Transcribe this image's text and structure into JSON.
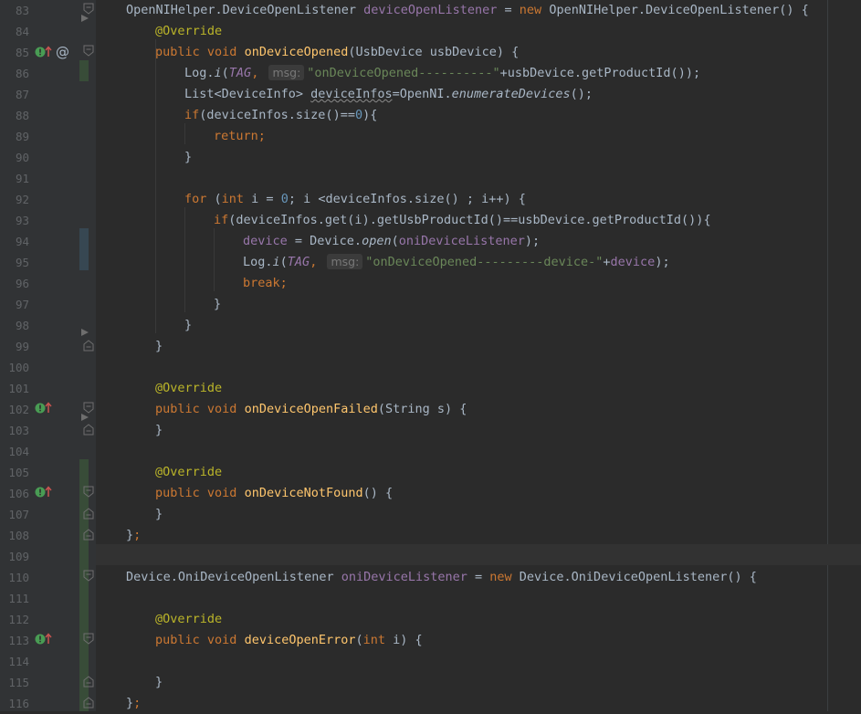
{
  "editor": {
    "colors": {
      "background": "#2b2b2b",
      "gutter": "#313335",
      "keyword": "#cc7832",
      "annotation": "#bbb529",
      "string": "#6a8759",
      "number": "#6897bb",
      "field": "#9876aa",
      "method_decl": "#ffc66d",
      "text": "#a9b7c6"
    },
    "line_numbers": [
      "83",
      "84",
      "85",
      "86",
      "87",
      "88",
      "89",
      "90",
      "91",
      "92",
      "93",
      "94",
      "95",
      "96",
      "97",
      "98",
      "99",
      "100",
      "101",
      "102",
      "103",
      "104",
      "105",
      "106",
      "107",
      "108",
      "109",
      "110",
      "111",
      "112",
      "113",
      "114",
      "115",
      "116"
    ],
    "tokens": {
      "l83_a": "OpenNIHelper.DeviceOpenListener ",
      "l83_b": "deviceOpenListener",
      "l83_c": " = ",
      "l83_d": "new",
      "l83_e": " OpenNIHelper.DeviceOpenListener() {",
      "override": "@Override",
      "public": "public",
      "void": "void",
      "l85_fn": "onDeviceOpened",
      "l85_rest": "(UsbDevice usbDevice) {",
      "log": "Log.",
      "i": "i",
      "tag": "TAG",
      "msg_hint": "msg:",
      "l86_str": "\"onDeviceOpened----------\"",
      "l86_rest": "+usbDevice.getProductId());",
      "l87_a": "List<DeviceInfo> ",
      "l87_b": "deviceInfos",
      "l87_c": "=OpenNI.",
      "l87_d": "enumerateDevices",
      "l87_e": "();",
      "if": "if",
      "l88_a": "(deviceInfos.size()==",
      "zero": "0",
      "l88_b": "){",
      "return": "return;",
      "close_brace": "}",
      "for": "for",
      "int": "int",
      "l92_a": " (",
      "l92_b": " i = ",
      "l92_c": "; i <deviceInfos.size() ; i++) {",
      "l93_a": "(deviceInfos.get(i).getUsbProductId()==usbDevice.getProductId()){",
      "device": "device",
      "l94_a": " = Device.",
      "open": "open",
      "l94_b": "(",
      "oni_listener": "oniDeviceListener",
      "l94_c": ");",
      "l95_str": "\"onDeviceOpened---------device-\"",
      "plus": "+",
      "l95_c": ");",
      "break": "break;",
      "l102_fn": "onDeviceOpenFailed",
      "l102_rest": "(String s) {",
      "l106_fn": "onDeviceNotFound",
      "l106_rest": "() {",
      "close_semi": "};",
      "l110_a": "Device.OniDeviceOpenListener ",
      "l110_c": " = ",
      "l110_d": "new",
      "l110_e": " Device.OniDeviceOpenListener() {",
      "l113_fn": "deviceOpenError",
      "l113_a": "(",
      "l113_b": " i) {",
      "at": "@",
      "paren_open": "(",
      "comma": ", ",
      "semi": ";",
      "space": " "
    }
  }
}
